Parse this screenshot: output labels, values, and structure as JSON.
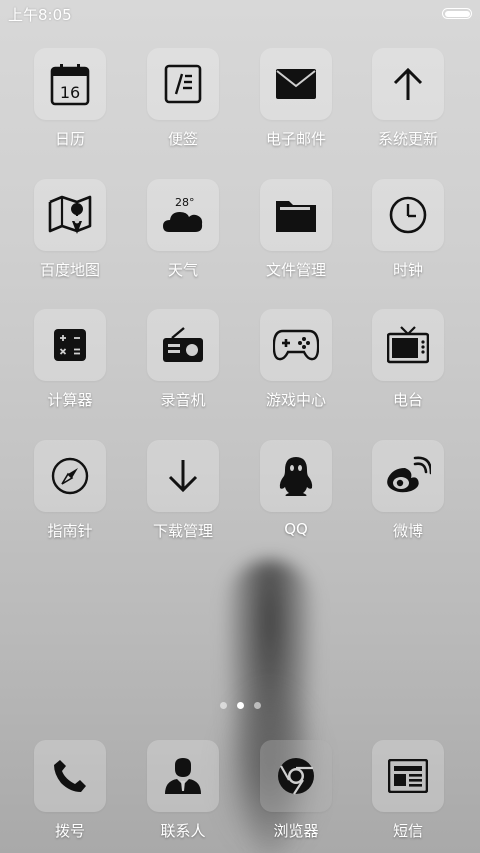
{
  "status_bar": {
    "time": "上午8:05",
    "battery_level": 1.0
  },
  "apps": [
    {
      "label": "日历",
      "icon": "calendar-icon",
      "icon_text": "16"
    },
    {
      "label": "便签",
      "icon": "notes-icon"
    },
    {
      "label": "电子邮件",
      "icon": "mail-icon"
    },
    {
      "label": "系统更新",
      "icon": "arrow-up-icon"
    },
    {
      "label": "百度地图",
      "icon": "map-icon"
    },
    {
      "label": "天气",
      "icon": "weather-icon",
      "icon_text": "28°"
    },
    {
      "label": "文件管理",
      "icon": "folder-icon"
    },
    {
      "label": "时钟",
      "icon": "clock-icon"
    },
    {
      "label": "计算器",
      "icon": "calculator-icon"
    },
    {
      "label": "录音机",
      "icon": "radio-icon"
    },
    {
      "label": "游戏中心",
      "icon": "gamepad-icon"
    },
    {
      "label": "电台",
      "icon": "tv-icon"
    },
    {
      "label": "指南针",
      "icon": "compass-icon"
    },
    {
      "label": "下载管理",
      "icon": "arrow-down-icon"
    },
    {
      "label": "QQ",
      "icon": "qq-penguin-icon"
    },
    {
      "label": "微博",
      "icon": "weibo-icon"
    }
  ],
  "page_indicator": {
    "count": 3,
    "active_index": 1
  },
  "dock": [
    {
      "label": "拨号",
      "icon": "phone-icon"
    },
    {
      "label": "联系人",
      "icon": "contacts-icon"
    },
    {
      "label": "浏览器",
      "icon": "chrome-icon"
    },
    {
      "label": "短信",
      "icon": "news-icon"
    }
  ],
  "colors": {
    "icon": "#111111",
    "label": "#ffffff"
  }
}
